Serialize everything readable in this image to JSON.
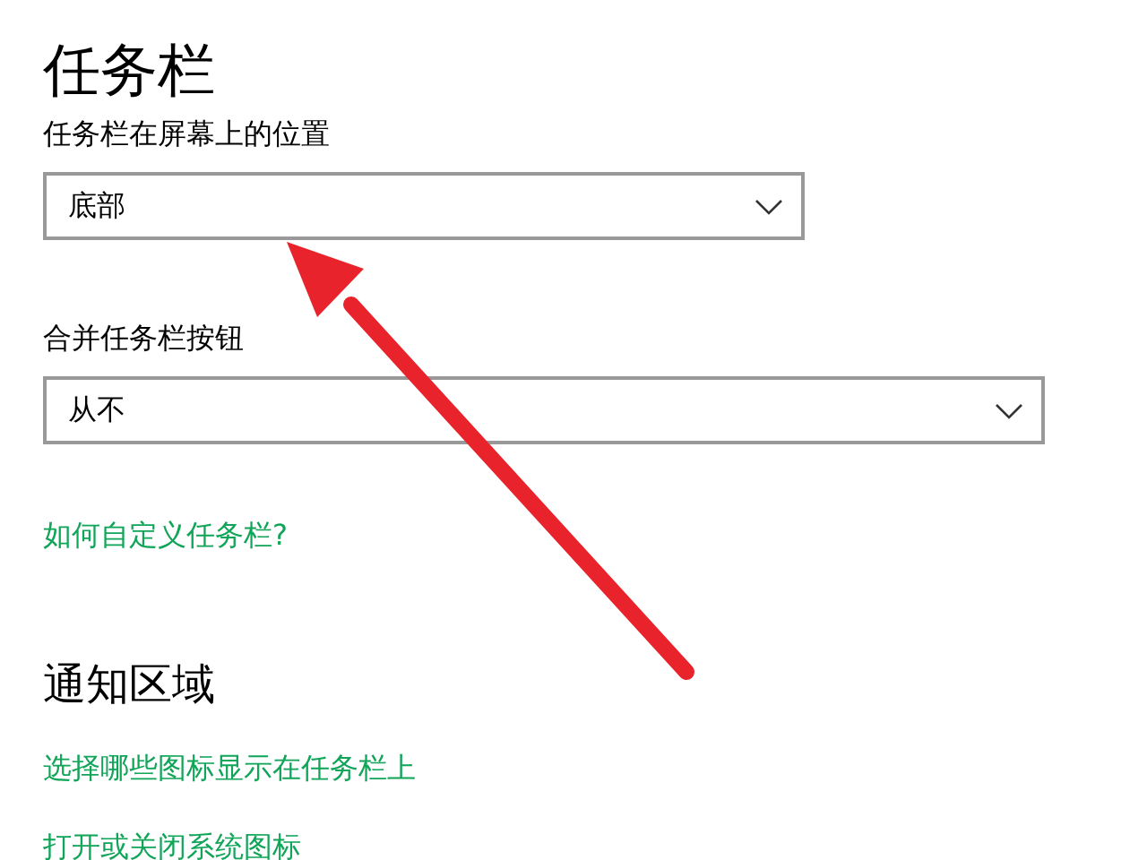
{
  "title": "任务栏",
  "dropdowns": [
    {
      "label": "任务栏在屏幕上的位置",
      "value": "底部",
      "wide": false
    },
    {
      "label": "合并任务栏按钮",
      "value": "从不",
      "wide": true
    }
  ],
  "help_link": "如何自定义任务栏?",
  "notification_area": {
    "heading": "通知区域",
    "links": [
      "选择哪些图标显示在任务栏上",
      "打开或关闭系统图标"
    ]
  }
}
